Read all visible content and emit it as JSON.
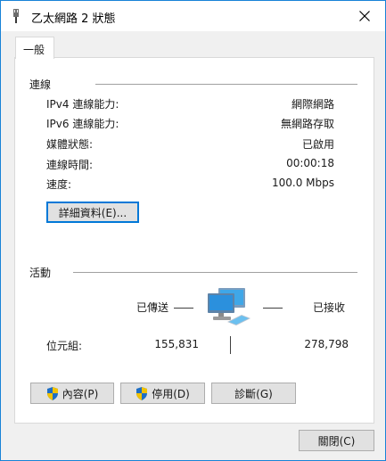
{
  "window": {
    "title": "乙太網路 2 狀態"
  },
  "tabs": [
    {
      "label": "一般"
    }
  ],
  "connection": {
    "header": "連線",
    "rows": [
      {
        "label": "IPv4 連線能力:",
        "value": "網際網路"
      },
      {
        "label": "IPv6 連線能力:",
        "value": "無網路存取"
      },
      {
        "label": "媒體狀態:",
        "value": "已啟用"
      },
      {
        "label": "連線時間:",
        "value": "00:00:18"
      },
      {
        "label": "速度:",
        "value": "100.0 Mbps"
      }
    ],
    "details_button": "詳細資料(E)..."
  },
  "activity": {
    "header": "活動",
    "sent_label": "已傳送",
    "received_label": "已接收",
    "bytes_label": "位元組:",
    "bytes_sent": "155,831",
    "bytes_received": "278,798"
  },
  "actions": {
    "properties": "內容(P)",
    "disable": "停用(D)",
    "diagnose": "診斷(G)"
  },
  "footer": {
    "close": "關閉(C)"
  },
  "icons": [
    "network-adapter-icon",
    "close-icon",
    "network-computers-icon",
    "shield-icon"
  ],
  "colors": {
    "accent": "#0078d7",
    "window_border": "#1883d7",
    "button_bg": "#e1e1e1"
  }
}
